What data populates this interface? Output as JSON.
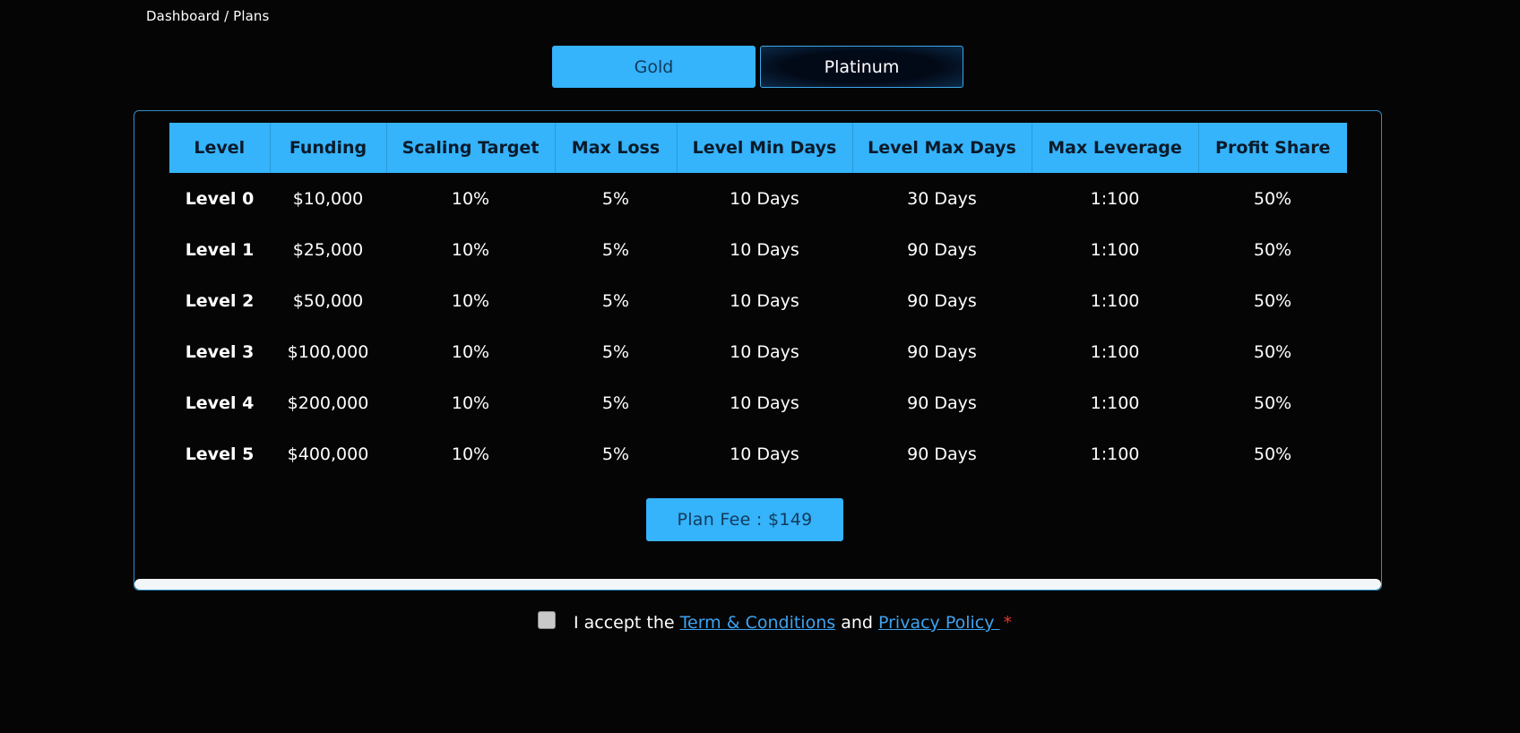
{
  "breadcrumb": "Dashboard / Plans",
  "plan_tabs": [
    {
      "label": "Gold",
      "active": true
    },
    {
      "label": "Platinum",
      "active": false
    }
  ],
  "table": {
    "headers": [
      "Level",
      "Funding",
      "Scaling Target",
      "Max Loss",
      "Level Min Days",
      "Level Max Days",
      "Max Leverage",
      "Profit Share"
    ],
    "rows": [
      [
        "Level 0",
        "$10,000",
        "10%",
        "5%",
        "10 Days",
        "30 Days",
        "1:100",
        "50%"
      ],
      [
        "Level 1",
        "$25,000",
        "10%",
        "5%",
        "10 Days",
        "90 Days",
        "1:100",
        "50%"
      ],
      [
        "Level 2",
        "$50,000",
        "10%",
        "5%",
        "10 Days",
        "90 Days",
        "1:100",
        "50%"
      ],
      [
        "Level 3",
        "$100,000",
        "10%",
        "5%",
        "10 Days",
        "90 Days",
        "1:100",
        "50%"
      ],
      [
        "Level 4",
        "$200,000",
        "10%",
        "5%",
        "10 Days",
        "90 Days",
        "1:100",
        "50%"
      ],
      [
        "Level 5",
        "$400,000",
        "10%",
        "5%",
        "10 Days",
        "90 Days",
        "1:100",
        "50%"
      ]
    ]
  },
  "fee_button": "Plan Fee : $149",
  "accept": {
    "prefix": "I accept the ",
    "terms_link": "Term & Conditions",
    "middle": " and ",
    "privacy_link": "Privacy Policy ",
    "required_mark": "*",
    "checked": false
  },
  "colors": {
    "accent": "#35b3fb",
    "background": "#050505",
    "link": "#3ea3f0",
    "required": "#e53935"
  }
}
